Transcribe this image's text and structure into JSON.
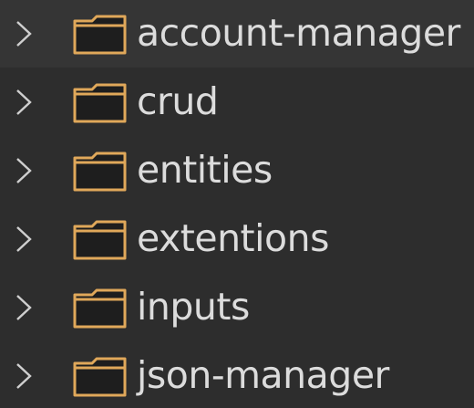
{
  "explorer": {
    "folders": [
      {
        "label": "account-manager",
        "icon": "folder-icon",
        "state": "collapsed"
      },
      {
        "label": "crud",
        "icon": "folder-icon",
        "state": "collapsed"
      },
      {
        "label": "entities",
        "icon": "folder-icon",
        "state": "collapsed"
      },
      {
        "label": "extentions",
        "icon": "folder-icon",
        "state": "collapsed"
      },
      {
        "label": "inputs",
        "icon": "folder-icon",
        "state": "collapsed"
      },
      {
        "label": "json-manager",
        "icon": "folder-icon",
        "state": "collapsed"
      }
    ]
  },
  "colors": {
    "background": "#2d2d2d",
    "text": "#dcdcdc",
    "folder_fill": "#1e1e1e",
    "folder_outline": "#e0a85a",
    "chevron": "#cfcfcf"
  }
}
